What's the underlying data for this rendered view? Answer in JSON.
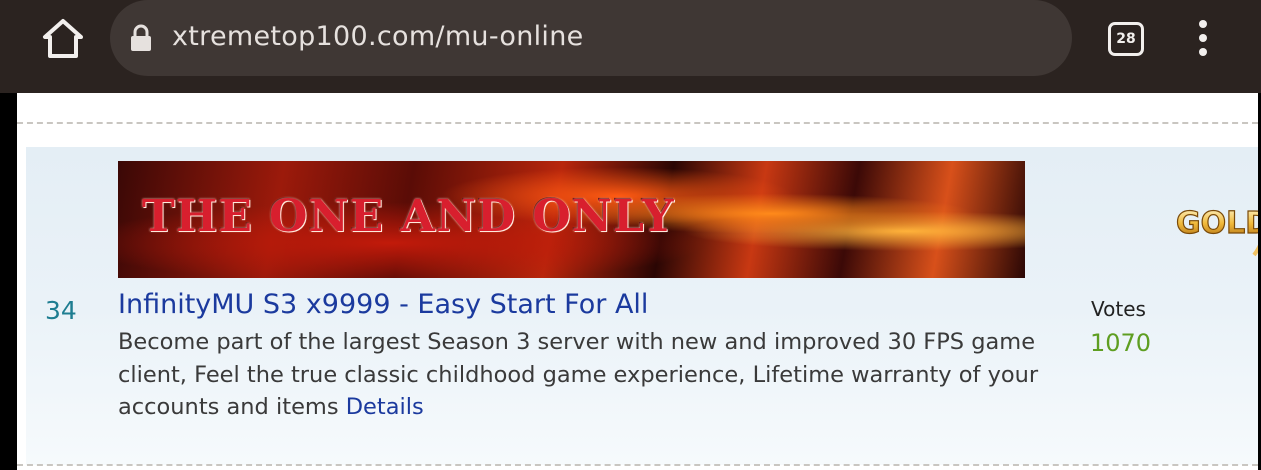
{
  "browser": {
    "url": "xtremetop100.com/mu-online",
    "tab_count": "28",
    "icons": {
      "home": "home-icon",
      "lock": "lock-icon",
      "tabs": "tab-switcher-icon",
      "menu": "more-vert-icon"
    }
  },
  "listing": {
    "banner_text": "THE ONE AND ONLY",
    "badge_text": "GOLD",
    "rank": "34",
    "title": "InfinityMU S3 x9999 - Easy Start For All",
    "description": "Become part of the largest Season 3 server with new and improved 30 FPS game client, Feel the true classic childhood game experience, Lifetime warranty of your accounts and items",
    "details_label": "Details",
    "votes_label": "Votes",
    "votes_count": "1070"
  },
  "colors": {
    "toolbar_bg": "#2b2320",
    "urlbar_bg": "#3f3734",
    "link": "#1b3a9e",
    "rank": "#1e7d91",
    "votes": "#5e9e21"
  }
}
